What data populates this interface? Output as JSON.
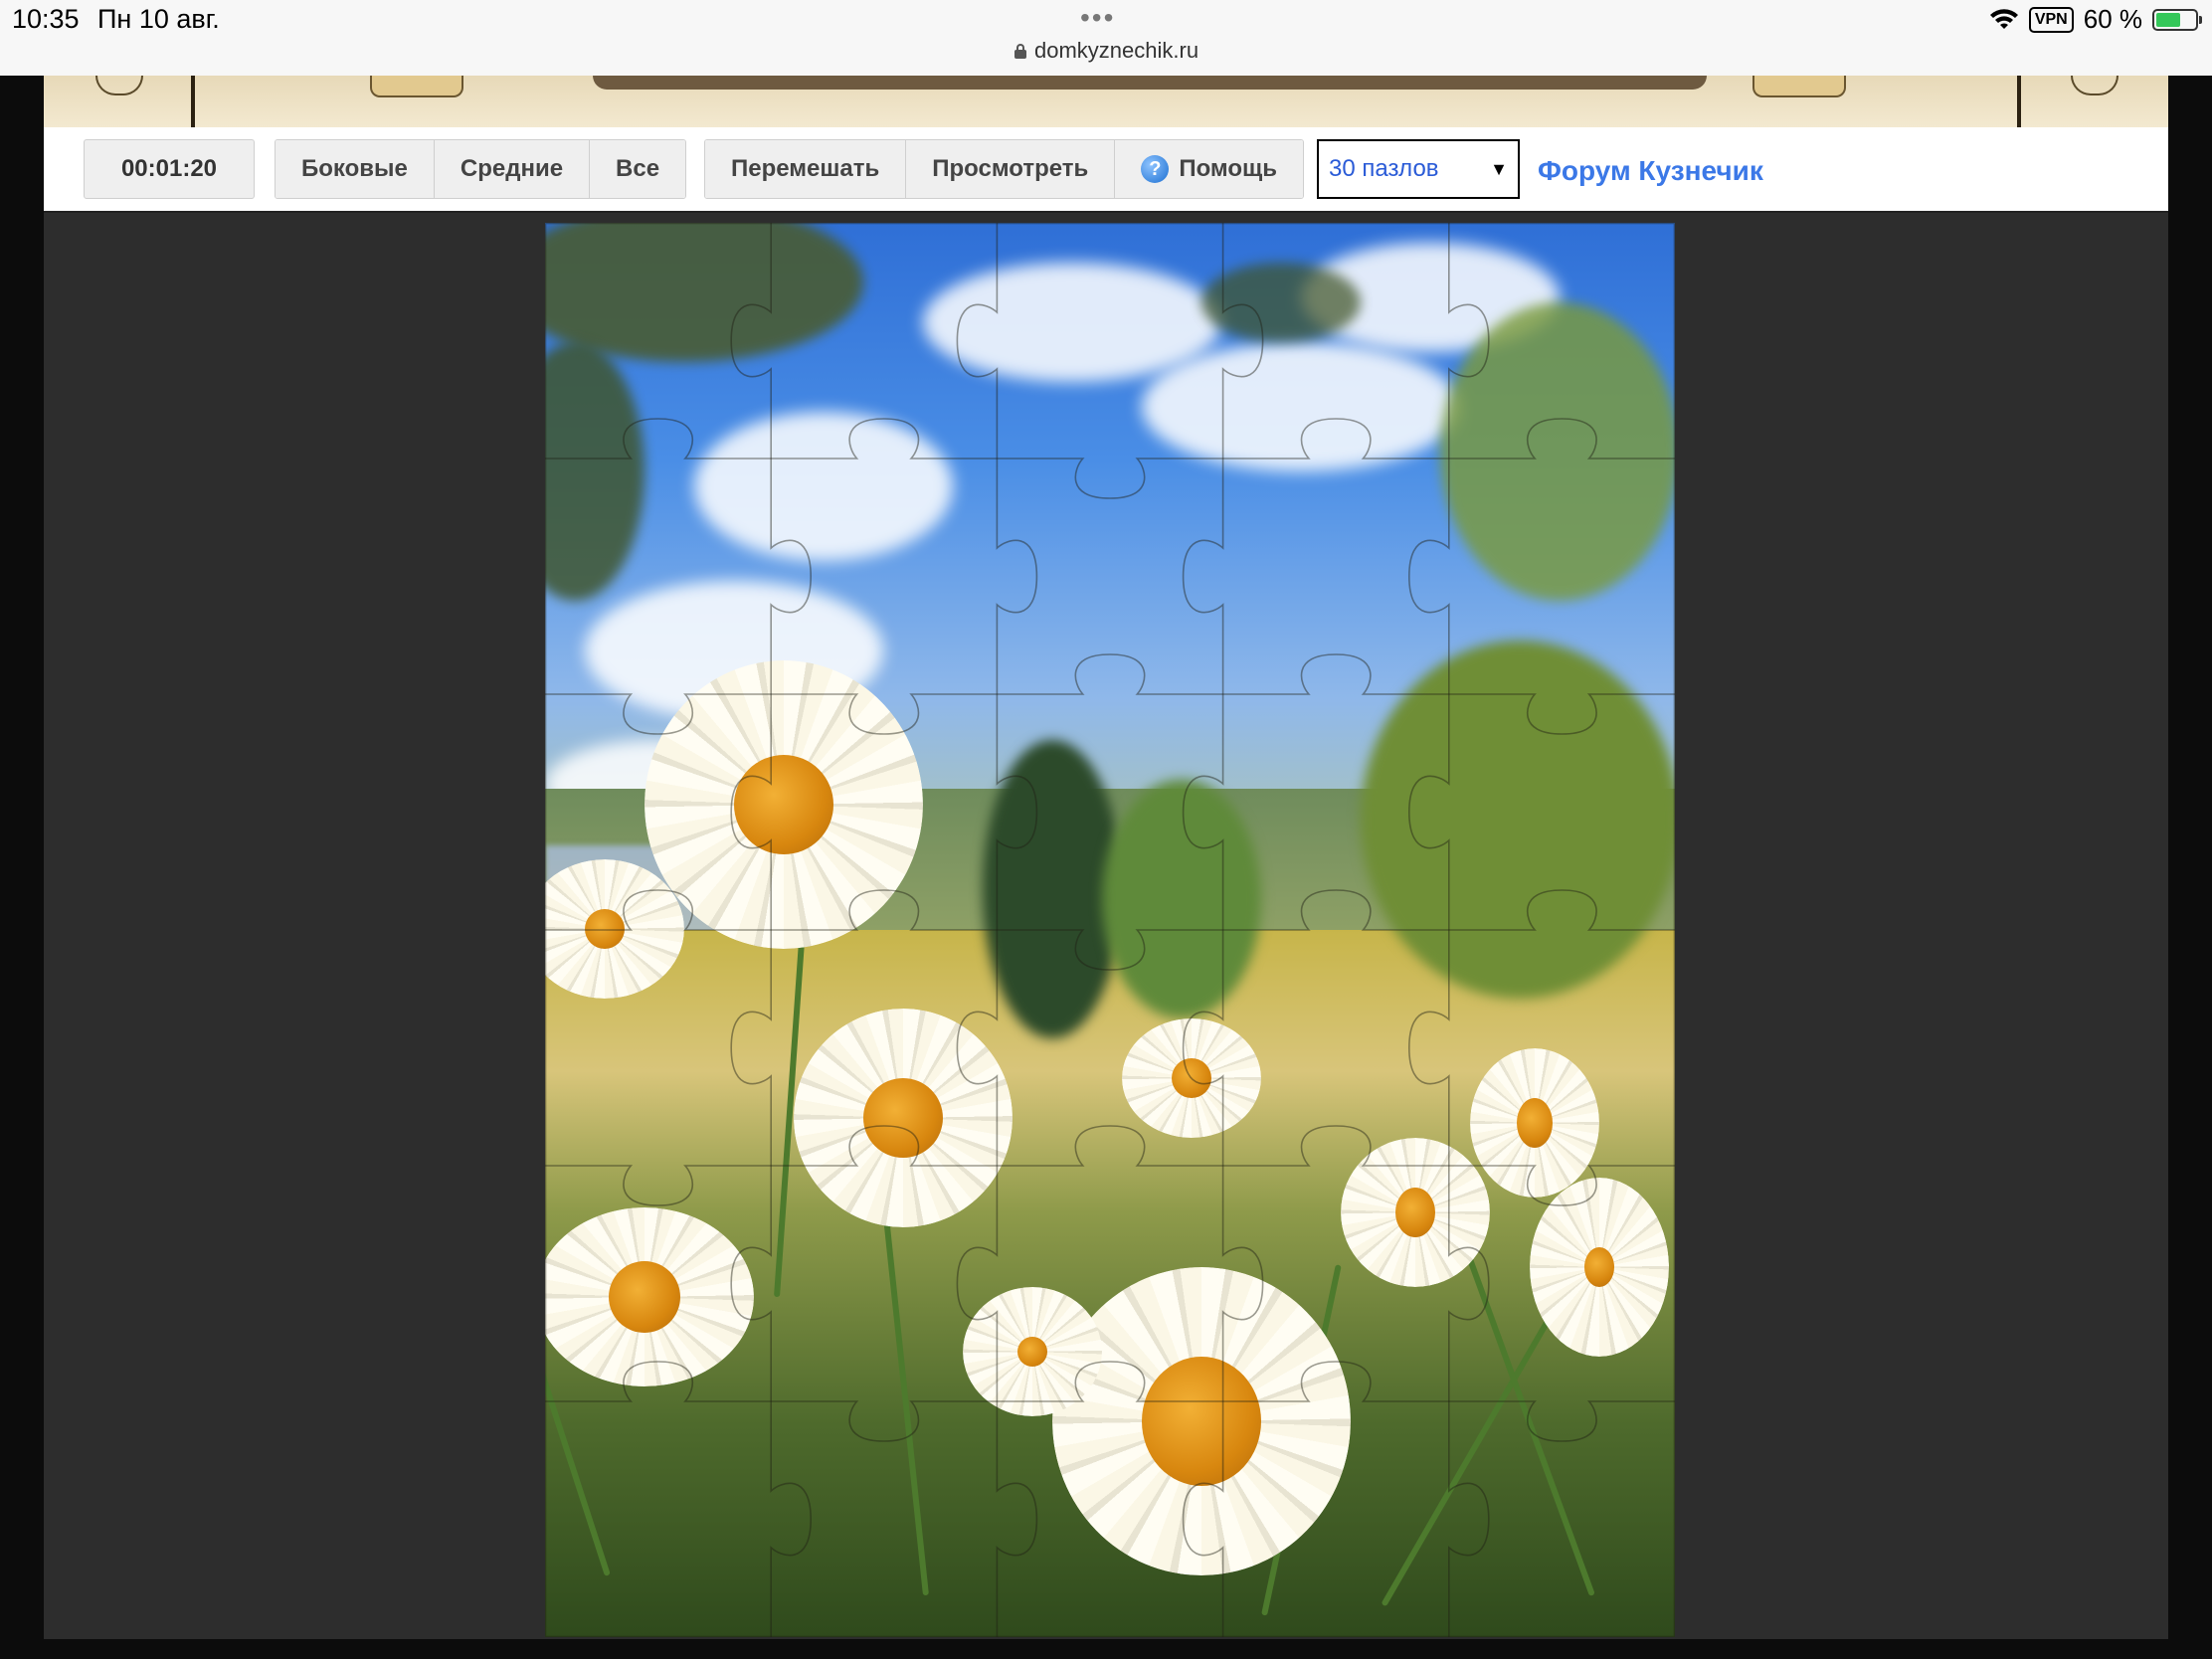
{
  "status_bar": {
    "time": "10:35",
    "date": "Пн 10 авг.",
    "url": "domkyznechik.ru",
    "vpn": "VPN",
    "battery": "60 %",
    "battery_level": 0.6
  },
  "toolbar": {
    "timer": "00:01:20",
    "filter_buttons": [
      "Боковые",
      "Средние",
      "Все"
    ],
    "action_buttons": {
      "shuffle": "Перемешать",
      "preview": "Просмотреть",
      "help": "Помощь"
    },
    "piece_count_select": "30 пазлов",
    "forum_link": "Форум Кузнечик"
  },
  "puzzle": {
    "columns": 5,
    "rows": 6,
    "image_icon": "daisy-meadow-image"
  },
  "colors": {
    "workspace_bg": "#2d2d2d",
    "link": "#3b78e7",
    "select_text": "#2a5bd7"
  }
}
